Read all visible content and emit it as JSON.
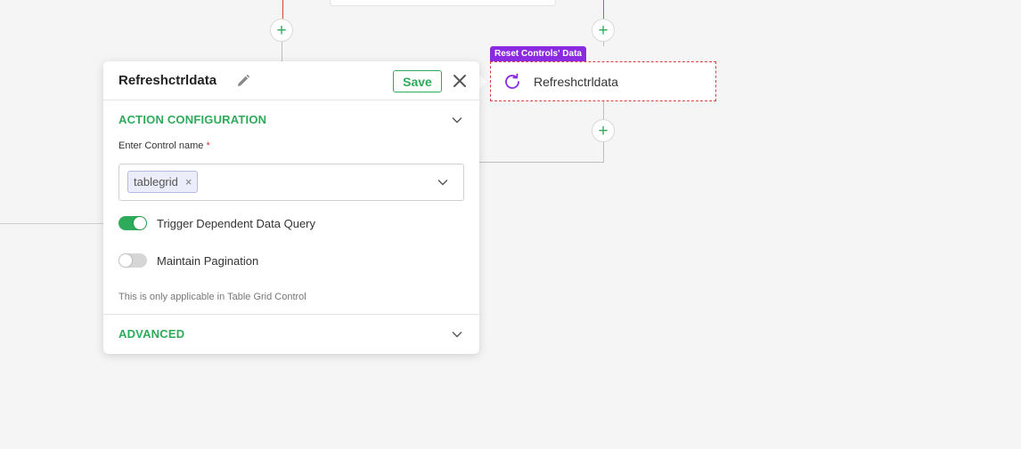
{
  "canvas": {
    "colors": {
      "green": "#2eab5a",
      "red": "#d84040",
      "gray": "#bdbdbd",
      "purple": "#8a2be2"
    },
    "plus_icon": "+"
  },
  "node": {
    "tag": "Reset Controls' Data",
    "label": "Refreshctrldata",
    "icon": "refresh-icon"
  },
  "panel": {
    "title": "Refreshctrldata",
    "save_label": "Save",
    "sections": {
      "action_configuration": "ACTION CONFIGURATION",
      "advanced": "ADVANCED"
    },
    "control_field": {
      "label": "Enter Control name",
      "required_mark": "*",
      "chips": [
        "tablegrid"
      ],
      "chip_remove": "×"
    },
    "toggles": {
      "trigger_dependent": {
        "label": "Trigger Dependent Data Query",
        "on": true
      },
      "maintain_pagination": {
        "label": "Maintain Pagination",
        "on": false
      }
    },
    "hint": "This is only applicable in Table Grid Control"
  }
}
